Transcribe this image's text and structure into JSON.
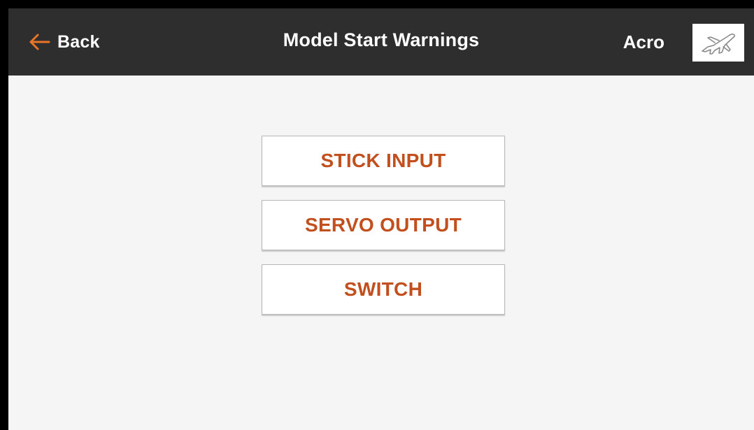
{
  "header": {
    "back_label": "Back",
    "title": "Model Start Warnings",
    "model_type": "Acro",
    "model_icon": "airplane-icon"
  },
  "menu": {
    "items": [
      {
        "label": "STICK INPUT"
      },
      {
        "label": "SERVO OUTPUT"
      },
      {
        "label": "SWITCH"
      }
    ]
  },
  "colors": {
    "header_bg": "#2e2e2e",
    "accent": "#e8742a",
    "button_text": "#c2501f",
    "background": "#f5f5f5"
  }
}
